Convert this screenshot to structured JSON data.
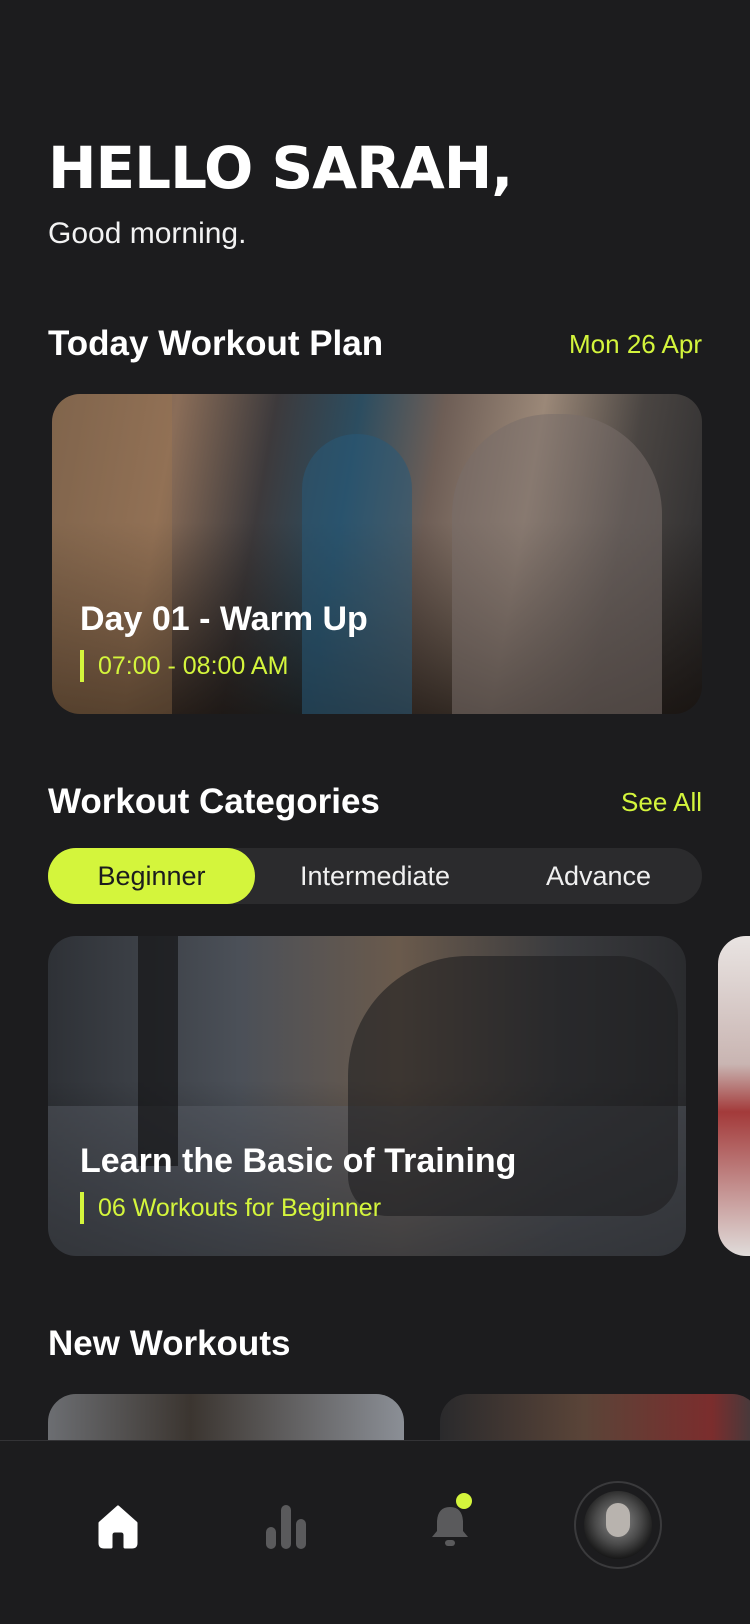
{
  "greeting": {
    "title": "HELLO SARAH,",
    "subtitle": "Good morning."
  },
  "today_plan": {
    "section_title": "Today Workout Plan",
    "date": "Mon 26 Apr",
    "card": {
      "title": "Day 01 - Warm Up",
      "time": "07:00 - 08:00 AM"
    }
  },
  "categories": {
    "section_title": "Workout Categories",
    "see_all": "See All",
    "tabs": [
      {
        "label": "Beginner",
        "active": true
      },
      {
        "label": "Intermediate",
        "active": false
      },
      {
        "label": "Advance",
        "active": false
      }
    ],
    "card": {
      "title": "Learn the Basic of Training",
      "meta": "06 Workouts  for Beginner"
    }
  },
  "new_workouts": {
    "section_title": "New Workouts"
  },
  "bottom_nav": {
    "items": [
      {
        "icon": "home-icon",
        "active": true
      },
      {
        "icon": "stats-icon",
        "active": false
      },
      {
        "icon": "bell-icon",
        "active": false,
        "badge": true
      },
      {
        "icon": "avatar",
        "active": false
      }
    ]
  },
  "colors": {
    "background": "#1c1c1e",
    "accent": "#d4f53c",
    "surface": "#2b2b2d"
  }
}
